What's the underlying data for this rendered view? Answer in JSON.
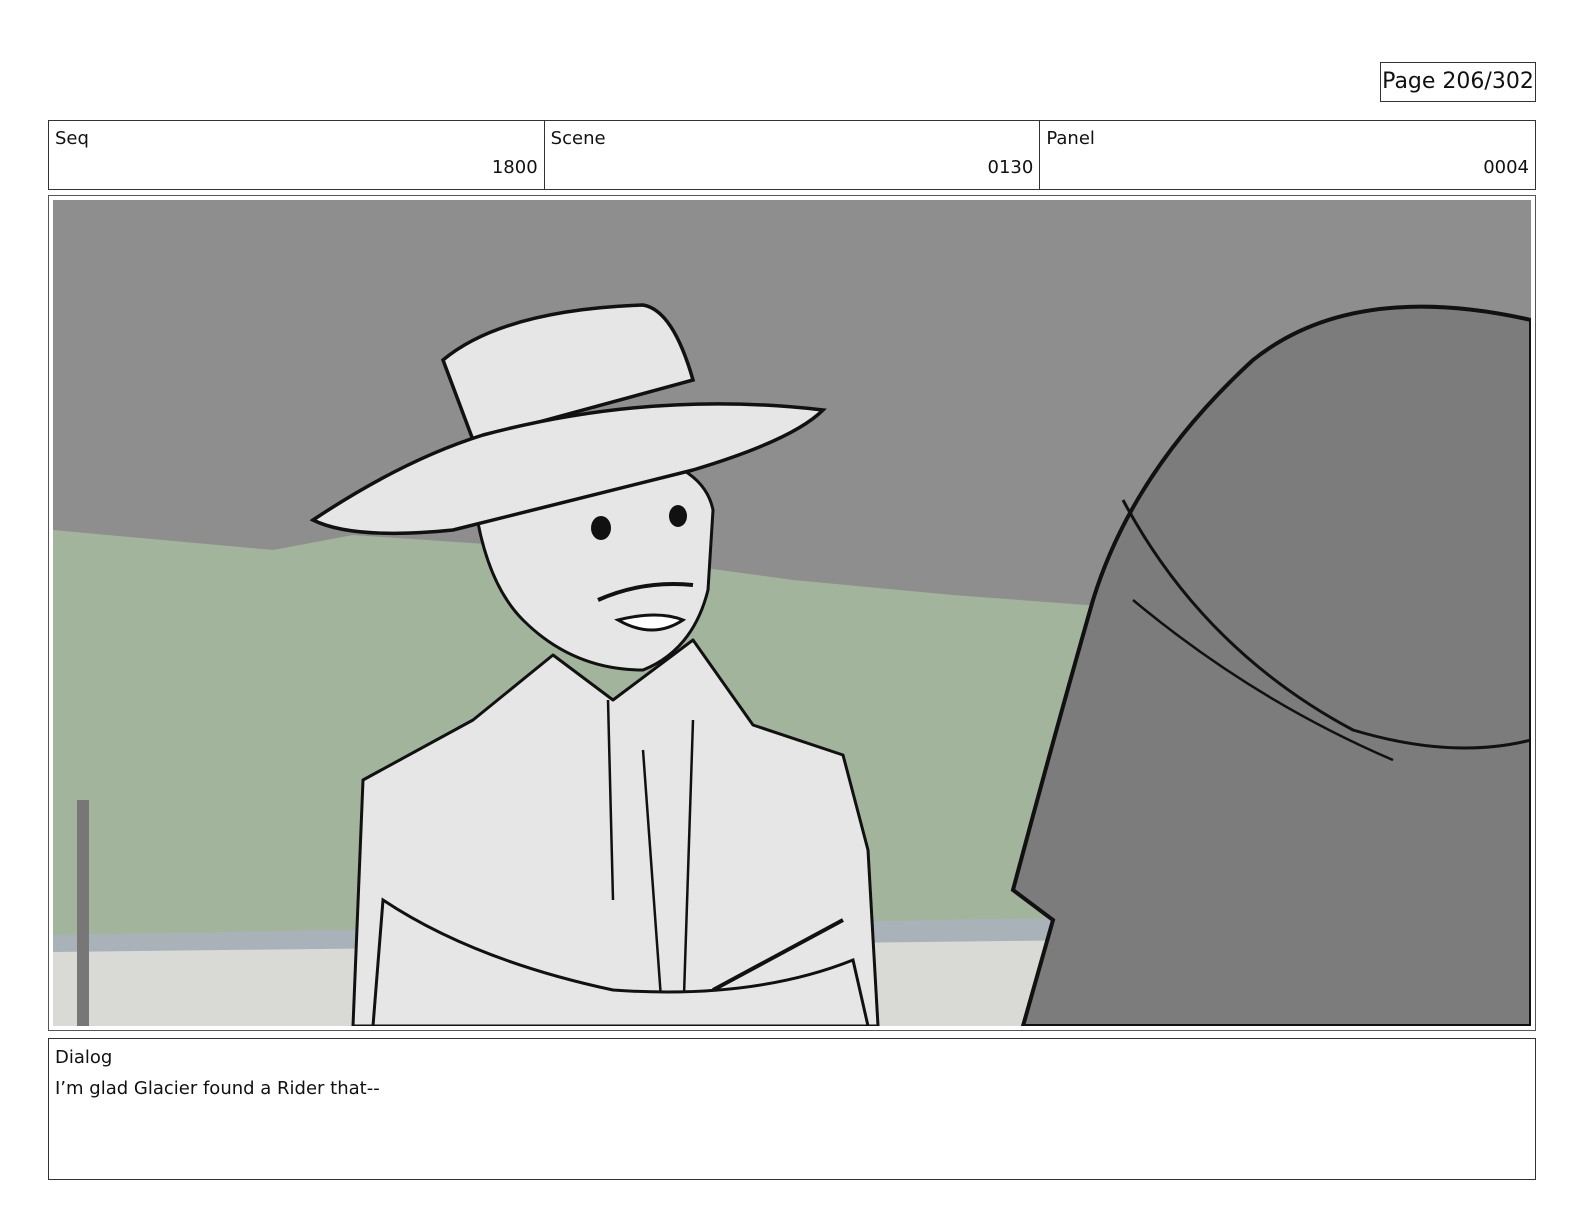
{
  "page": {
    "number_label": "Page 206/302"
  },
  "header": {
    "cells": [
      {
        "label": "Seq",
        "value": "1800"
      },
      {
        "label": "Scene",
        "value": "0130"
      },
      {
        "label": "Panel",
        "value": "0004"
      }
    ]
  },
  "dialog": {
    "label": "Dialog",
    "text": "I’m glad Glacier found a Rider that--"
  },
  "colors": {
    "sky": "#8e8e8e",
    "hills": "#a2b59c",
    "ground": "#d9d9d6",
    "character_fill": "#e6e6e6",
    "foreground_figure": "#7c7c7c",
    "line": "#111111"
  }
}
